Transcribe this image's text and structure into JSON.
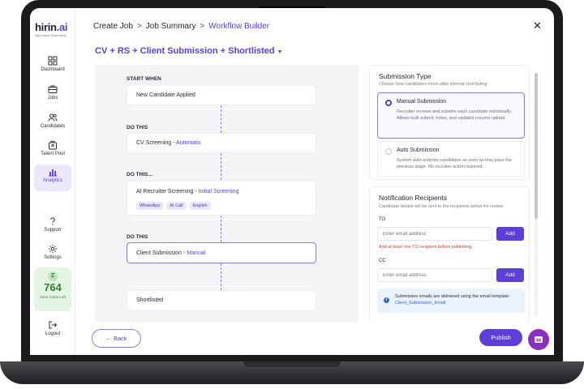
{
  "sidebar": {
    "logo": {
      "brand": "hirin",
      "brand_accent": ".ai",
      "tagline": "Right talent. Rapid hiring."
    },
    "items": [
      {
        "label": "Dashboard",
        "icon": "dashboard-icon"
      },
      {
        "label": "Jobs",
        "icon": "briefcase-icon"
      },
      {
        "label": "Candidates",
        "icon": "users-icon"
      },
      {
        "label": "Talent Pool",
        "icon": "talent-pool-icon"
      },
      {
        "label": "Analytics",
        "icon": "bar-chart-icon",
        "active": true
      },
      {
        "label": "Support",
        "icon": "help-icon"
      },
      {
        "label": "Settings",
        "icon": "gear-icon"
      },
      {
        "label": "Logout",
        "icon": "logout-icon"
      }
    ],
    "coins": {
      "badge": "Z",
      "value": "764",
      "label": "Zene Coins Left"
    }
  },
  "header": {
    "breadcrumbs": [
      "Create Job",
      "Job Summary",
      "Workflow Builder"
    ],
    "separator": ">"
  },
  "workflow": {
    "title": "CV + RS + Client Submission + Shortlisted",
    "steps": [
      {
        "label": "START WHEN",
        "name": "New Candidate Applied",
        "mode": ""
      },
      {
        "label": "DO THIS",
        "name": "CV Screening - ",
        "mode": "Automatic"
      },
      {
        "label": "DO THIS...",
        "name": "AI Recruiter Screening - ",
        "mode": "Initial Screening",
        "chips": [
          "WhatsApp",
          "AI Call",
          "English"
        ]
      },
      {
        "label": "DO THIS",
        "name": "Client Submission - ",
        "mode": "Manual"
      },
      {
        "label": "",
        "name": "Shortlisted",
        "mode": ""
      }
    ]
  },
  "submission": {
    "title": "Submission Type",
    "subtitle": "Choose how candidates move after internal shortlisting.",
    "options": [
      {
        "title": "Manual Submission",
        "desc": "Recruiter reviews and submits each candidate individually. Allows bulk submit, notes, and updated resume upload.",
        "selected": true
      },
      {
        "title": "Auto Submission",
        "desc": "System auto-submits candidates as soon as they pass the previous stage. No recruiter action required.",
        "selected": false
      }
    ]
  },
  "recipients": {
    "title": "Notification Recipients",
    "subtitle": "Candidate details will be sent to the recipients below for review.",
    "to_label": "TO",
    "cc_label": "CC",
    "placeholder": "Enter email address",
    "add_label": "Add",
    "error": "Add at least one TO recipient before publishing.",
    "info_text": "Submission emails are delivered using the email template: ",
    "info_template": "Client_Submission_Email"
  },
  "footer": {
    "back_label": "← Back",
    "publish_label": "Publish"
  },
  "colors": {
    "accent": "#5b3fd6",
    "error": "#d93a3a",
    "coins": "#2f7f2b",
    "chat": "#8a2fc4"
  }
}
